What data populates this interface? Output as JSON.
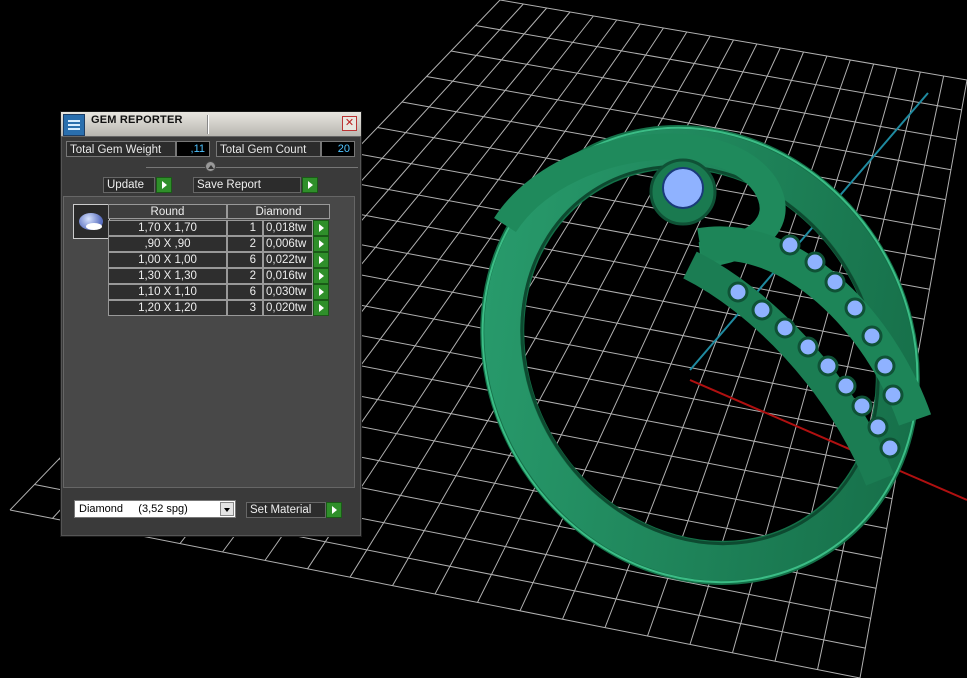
{
  "window": {
    "title": "GEM REPORTER",
    "close_symbol": "✕"
  },
  "totals": {
    "weight_label": "Total Gem Weight",
    "weight_value": ",11",
    "count_label": "Total Gem Count",
    "count_value": "20"
  },
  "buttons": {
    "update_label": "Update",
    "save_report_label": "Save Report",
    "set_material_label": "Set Material"
  },
  "table": {
    "shape_header": "Round",
    "material_header": "Diamond",
    "rows": [
      {
        "size": "1,70 X 1,70",
        "count": "1",
        "weight": "0,018tw"
      },
      {
        "size": ",90 X ,90",
        "count": "2",
        "weight": "0,006tw"
      },
      {
        "size": "1,00 X 1,00",
        "count": "6",
        "weight": "0,022tw"
      },
      {
        "size": "1,30 X 1,30",
        "count": "2",
        "weight": "0,016tw"
      },
      {
        "size": "1,10 X 1,10",
        "count": "6",
        "weight": "0,030tw"
      },
      {
        "size": "1,20 X 1,20",
        "count": "3",
        "weight": "0,020tw"
      }
    ]
  },
  "material_select": {
    "selected": "Diamond     (3,52 spg)"
  },
  "colors": {
    "ring_green": "#1f8a5c",
    "gem_blue": "#8fb2ff",
    "grid_line": "#d8d8d8",
    "axis_cyan": "#1f8aa0",
    "axis_red": "#b01010",
    "value_text": "#4fc3ff",
    "go_button": "#2f8f2a"
  },
  "icons": {
    "app": "report-icon",
    "gem": "round-diamond-icon",
    "close": "close-icon",
    "go": "play-arrow-icon",
    "dropdown": "chevron-down-icon"
  }
}
